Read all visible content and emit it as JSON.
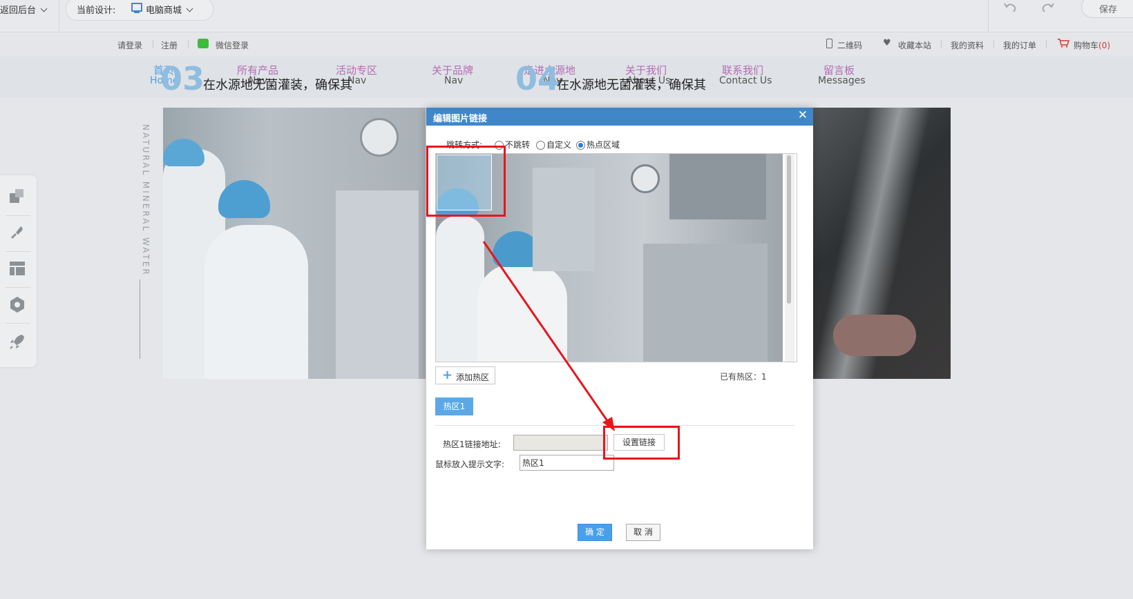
{
  "topbar": {
    "back_label": "返回后台",
    "current_design_label": "当前设计:",
    "design_value": "电脑商城",
    "save_label": "保存"
  },
  "site_top": {
    "login": "请登录",
    "register": "注册",
    "wechat_login": "微信登录",
    "qrcode": "二维码",
    "favorite": "收藏本站",
    "my_profile": "我的资料",
    "my_orders": "我的订单",
    "cart": "购物车",
    "cart_count": "(0)"
  },
  "nav": {
    "items": [
      {
        "cn": "首页",
        "en": "Home"
      },
      {
        "cn": "所有产品",
        "en": "Nav"
      },
      {
        "cn": "活动专区",
        "en": "Nav"
      },
      {
        "cn": "关于品牌",
        "en": "Nav"
      },
      {
        "cn": "走进水源地",
        "en": "Nav"
      },
      {
        "cn": "关于我们",
        "en": "About Us"
      },
      {
        "cn": "联系我们",
        "en": "Contact Us"
      },
      {
        "cn": "留言板",
        "en": "Messages"
      }
    ]
  },
  "overlay": {
    "num1": "03",
    "num2": "04",
    "slogan1": "在水源地无菌灌装，确保其",
    "slogan2": "在水源地无菌灌装，确保其"
  },
  "banner": {
    "vertical_text": "NATURAL MINERAL WATER"
  },
  "dialog": {
    "title": "编辑图片链接",
    "close": "✕",
    "jump_label": "跳转方式:",
    "options": [
      "不跳转",
      "自定义",
      "热点区域"
    ],
    "selected_option": "热点区域",
    "add_hotspot_label": "添加热区",
    "hotspot_count_label": "已有热区：1",
    "hotspot_tab": "热区1",
    "link_label": "热区1链接地址:",
    "link_value": "",
    "set_link_label": "设置链接",
    "tooltip_label": "鼠标放入提示文字:",
    "tooltip_value": "热区1",
    "confirm_label": "确 定",
    "cancel_label": "取 消"
  },
  "colors": {
    "dialog_header": "#3f87c9",
    "accent": "#4a9fe8",
    "annotation_red": "#e8151b",
    "nav_cn": "#b36cb3"
  }
}
